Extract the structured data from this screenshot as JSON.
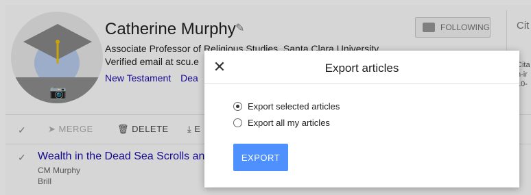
{
  "profile": {
    "name": "Catherine Murphy",
    "affiliation": "Associate Professor of Religious Studies, Santa Clara University",
    "email": "Verified email at scu.e",
    "tags": [
      "New Testament",
      "Dea"
    ],
    "follow_label": "FOLLOWING"
  },
  "citations": {
    "title": "Cit",
    "lines": [
      "Cita",
      "n-ir",
      "10-"
    ]
  },
  "toolbar": {
    "merge_label": "MERGE",
    "delete_label": "DELETE",
    "export_partial": "E"
  },
  "article": {
    "title": "Wealth in the Dead Sea Scrolls and",
    "author": "CM Murphy",
    "publisher": "Brill"
  },
  "modal": {
    "title": "Export articles",
    "close_glyph": "✕",
    "options": [
      {
        "label": "Export selected articles",
        "selected": true
      },
      {
        "label": "Export all my articles",
        "selected": false
      }
    ],
    "export_label": "EXPORT"
  },
  "colors": {
    "link": "#1a0dab",
    "primary_button": "#4d90fe"
  }
}
